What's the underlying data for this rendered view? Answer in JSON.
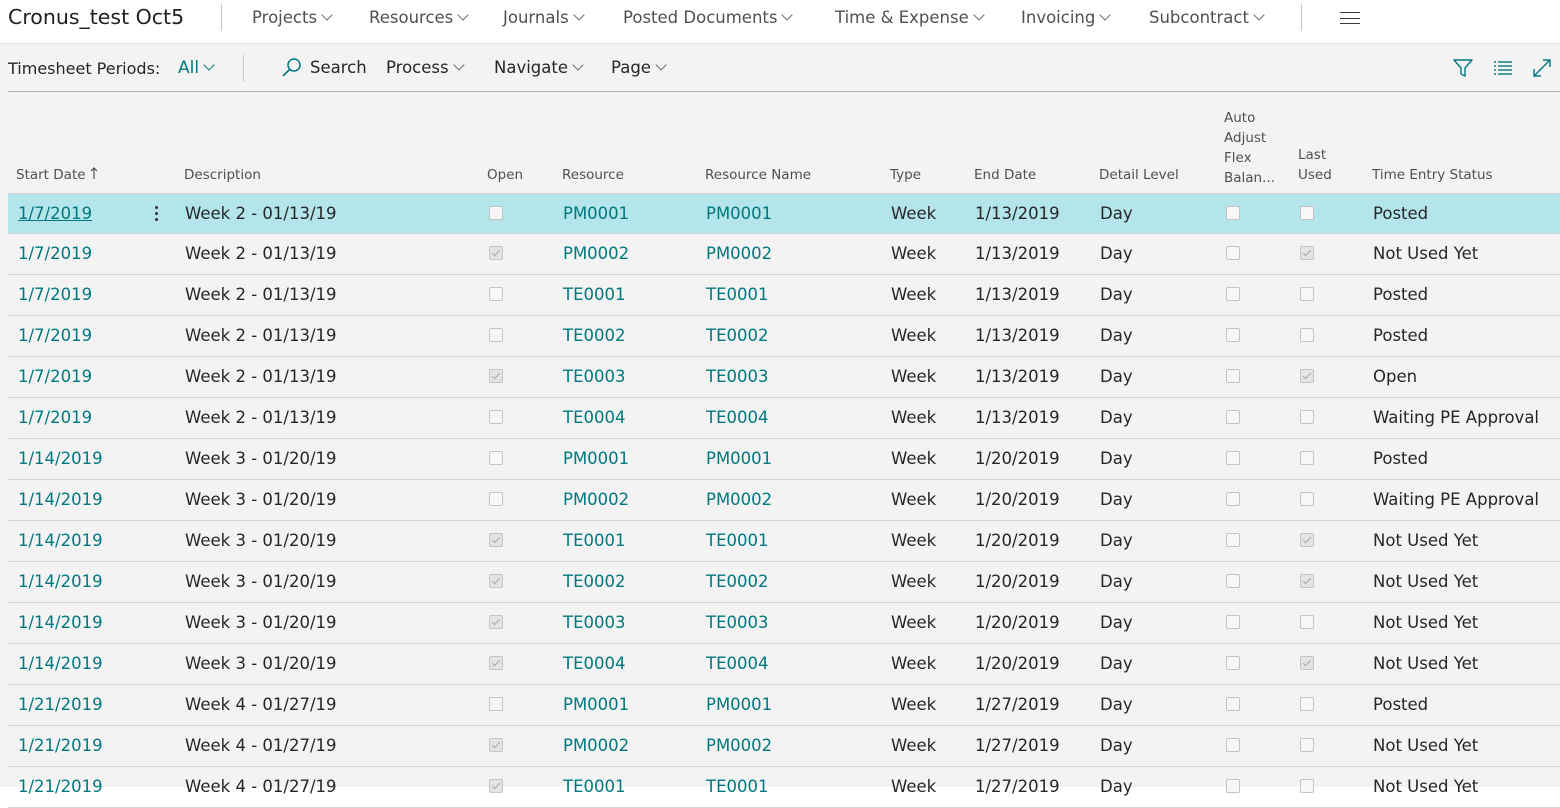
{
  "app": {
    "company": "Cronus_test Oct5",
    "nav": [
      {
        "label": "Projects"
      },
      {
        "label": "Resources"
      },
      {
        "label": "Journals"
      },
      {
        "label": "Posted Documents"
      },
      {
        "label": "Time & Expense"
      },
      {
        "label": "Invoicing"
      },
      {
        "label": "Subcontract"
      }
    ]
  },
  "page": {
    "title": "Timesheet Periods:",
    "filter": "All",
    "actions": {
      "search": "Search",
      "process": "Process",
      "navigate": "Navigate",
      "page": "Page"
    }
  },
  "table": {
    "headers": {
      "start_date": "Start Date",
      "description": "Description",
      "open": "Open",
      "resource": "Resource",
      "resource_name": "Resource Name",
      "type": "Type",
      "end_date": "End Date",
      "detail_level": "Detail Level",
      "auto_adjust": [
        "Auto",
        "Adjust",
        "Flex",
        "Balan..."
      ],
      "last_used": [
        "Last",
        "Used"
      ],
      "time_entry_status": "Time Entry Status"
    },
    "rows": [
      {
        "start": "1/7/2019",
        "desc": "Week 2 - 01/13/19",
        "open": false,
        "res": "PM0001",
        "name": "PM0001",
        "type": "Week",
        "end": "1/13/2019",
        "level": "Day",
        "auto": false,
        "last": false,
        "status": "Posted"
      },
      {
        "start": "1/7/2019",
        "desc": "Week 2 - 01/13/19",
        "open": true,
        "res": "PM0002",
        "name": "PM0002",
        "type": "Week",
        "end": "1/13/2019",
        "level": "Day",
        "auto": false,
        "last": true,
        "status": "Not Used Yet"
      },
      {
        "start": "1/7/2019",
        "desc": "Week 2 - 01/13/19",
        "open": false,
        "res": "TE0001",
        "name": "TE0001",
        "type": "Week",
        "end": "1/13/2019",
        "level": "Day",
        "auto": false,
        "last": false,
        "status": "Posted"
      },
      {
        "start": "1/7/2019",
        "desc": "Week 2 - 01/13/19",
        "open": false,
        "res": "TE0002",
        "name": "TE0002",
        "type": "Week",
        "end": "1/13/2019",
        "level": "Day",
        "auto": false,
        "last": false,
        "status": "Posted"
      },
      {
        "start": "1/7/2019",
        "desc": "Week 2 - 01/13/19",
        "open": true,
        "res": "TE0003",
        "name": "TE0003",
        "type": "Week",
        "end": "1/13/2019",
        "level": "Day",
        "auto": false,
        "last": true,
        "status": "Open"
      },
      {
        "start": "1/7/2019",
        "desc": "Week 2 - 01/13/19",
        "open": false,
        "res": "TE0004",
        "name": "TE0004",
        "type": "Week",
        "end": "1/13/2019",
        "level": "Day",
        "auto": false,
        "last": false,
        "status": "Waiting PE Approval"
      },
      {
        "start": "1/14/2019",
        "desc": "Week 3 - 01/20/19",
        "open": false,
        "res": "PM0001",
        "name": "PM0001",
        "type": "Week",
        "end": "1/20/2019",
        "level": "Day",
        "auto": false,
        "last": false,
        "status": "Posted"
      },
      {
        "start": "1/14/2019",
        "desc": "Week 3 - 01/20/19",
        "open": false,
        "res": "PM0002",
        "name": "PM0002",
        "type": "Week",
        "end": "1/20/2019",
        "level": "Day",
        "auto": false,
        "last": false,
        "status": "Waiting PE Approval"
      },
      {
        "start": "1/14/2019",
        "desc": "Week 3 - 01/20/19",
        "open": true,
        "res": "TE0001",
        "name": "TE0001",
        "type": "Week",
        "end": "1/20/2019",
        "level": "Day",
        "auto": false,
        "last": true,
        "status": "Not Used Yet"
      },
      {
        "start": "1/14/2019",
        "desc": "Week 3 - 01/20/19",
        "open": true,
        "res": "TE0002",
        "name": "TE0002",
        "type": "Week",
        "end": "1/20/2019",
        "level": "Day",
        "auto": false,
        "last": true,
        "status": "Not Used Yet"
      },
      {
        "start": "1/14/2019",
        "desc": "Week 3 - 01/20/19",
        "open": true,
        "res": "TE0003",
        "name": "TE0003",
        "type": "Week",
        "end": "1/20/2019",
        "level": "Day",
        "auto": false,
        "last": false,
        "status": "Not Used Yet"
      },
      {
        "start": "1/14/2019",
        "desc": "Week 3 - 01/20/19",
        "open": true,
        "res": "TE0004",
        "name": "TE0004",
        "type": "Week",
        "end": "1/20/2019",
        "level": "Day",
        "auto": false,
        "last": true,
        "status": "Not Used Yet"
      },
      {
        "start": "1/21/2019",
        "desc": "Week 4 - 01/27/19",
        "open": false,
        "res": "PM0001",
        "name": "PM0001",
        "type": "Week",
        "end": "1/27/2019",
        "level": "Day",
        "auto": false,
        "last": false,
        "status": "Posted"
      },
      {
        "start": "1/21/2019",
        "desc": "Week 4 - 01/27/19",
        "open": true,
        "res": "PM0002",
        "name": "PM0002",
        "type": "Week",
        "end": "1/27/2019",
        "level": "Day",
        "auto": false,
        "last": false,
        "status": "Not Used Yet"
      },
      {
        "start": "1/21/2019",
        "desc": "Week 4 - 01/27/19",
        "open": true,
        "res": "TE0001",
        "name": "TE0001",
        "type": "Week",
        "end": "1/27/2019",
        "level": "Day",
        "auto": false,
        "last": false,
        "status": "Not Used Yet"
      }
    ]
  },
  "colors": {
    "accent": "#00787f",
    "selected_row": "#b3e5ea",
    "list_background": "#f3f3f3"
  }
}
